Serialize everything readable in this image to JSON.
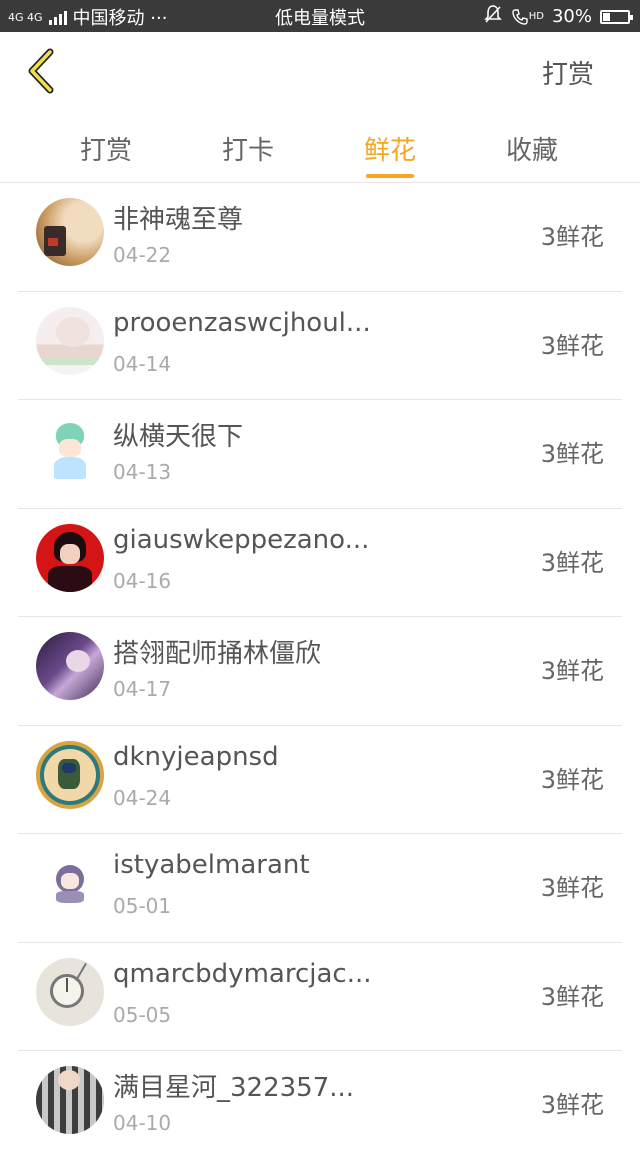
{
  "status_bar": {
    "network": "4G 4G",
    "carrier": "中国移动 ···",
    "mode": "低电量模式",
    "hd": "HD",
    "battery": "30%",
    "battery_level": 0.3
  },
  "header": {
    "back_icon": "chevron-left-icon",
    "action_label": "打赏"
  },
  "tabs": [
    {
      "label": "打赏",
      "active": false
    },
    {
      "label": "打卡",
      "active": false
    },
    {
      "label": "鲜花",
      "active": true
    },
    {
      "label": "收藏",
      "active": false
    }
  ],
  "colors": {
    "accent": "#f5a623",
    "status_bar": "#3a3a3a",
    "divider": "#e6e6e6"
  },
  "items": [
    {
      "name": "非神魂至尊",
      "date": "04-22",
      "amount": "3鲜花"
    },
    {
      "name": "prooenzaswcjhoul...",
      "date": "04-14",
      "amount": "3鲜花"
    },
    {
      "name": "纵横天很下",
      "date": "04-13",
      "amount": "3鲜花"
    },
    {
      "name": "giauswkeppezano...",
      "date": "04-16",
      "amount": "3鲜花"
    },
    {
      "name": "搭翎配师捅林僵欣",
      "date": "04-17",
      "amount": "3鲜花"
    },
    {
      "name": "dknyjeapnsd",
      "date": "04-24",
      "amount": "3鲜花"
    },
    {
      "name": "istyabelmarant",
      "date": "05-01",
      "amount": "3鲜花"
    },
    {
      "name": "qmarcbdymarcjac...",
      "date": "05-05",
      "amount": "3鲜花"
    },
    {
      "name": "满目星河_322357...",
      "date": "04-10",
      "amount": "3鲜花"
    }
  ]
}
